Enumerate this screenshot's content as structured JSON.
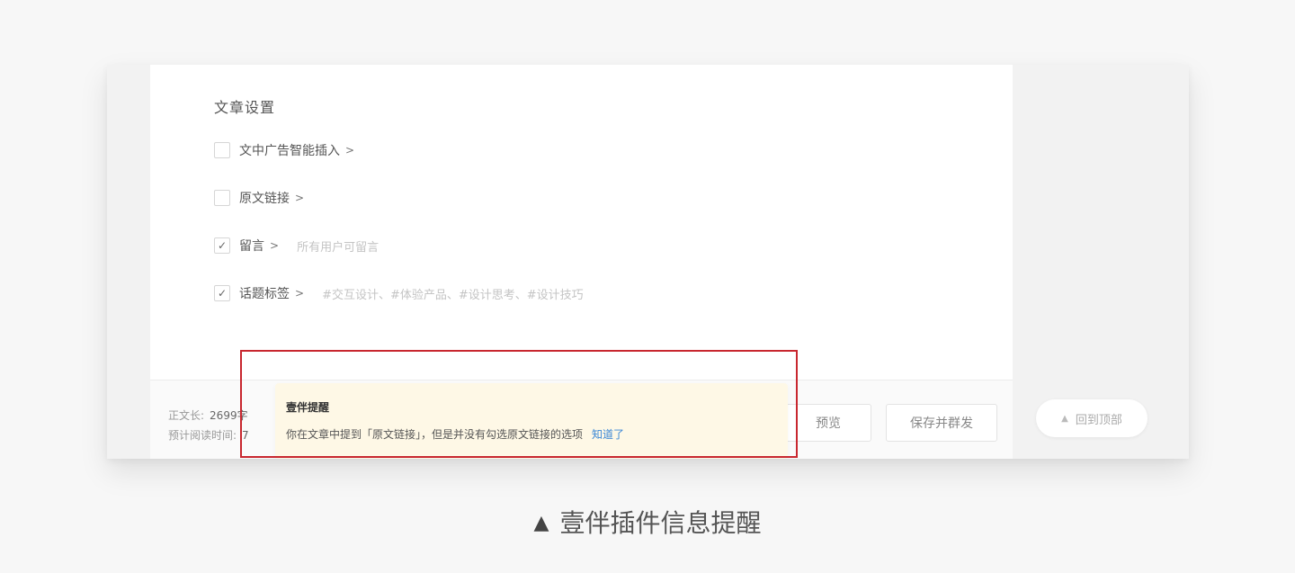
{
  "article_settings": {
    "title": "文章设置",
    "options": [
      {
        "label": "文中广告智能插入",
        "checked": false,
        "hint": ""
      },
      {
        "label": "原文链接",
        "checked": false,
        "hint": ""
      },
      {
        "label": "留言",
        "checked": true,
        "hint": "所有用户可留言"
      },
      {
        "label": "话题标签",
        "checked": true,
        "hint": "#交互设计、#体验产品、#设计思考、#设计技巧"
      }
    ]
  },
  "footer": {
    "word_count_label": "正文长:",
    "word_count_value": "2699字",
    "read_time_label": "预计阅读时间:",
    "read_time_value": "7"
  },
  "buttons": {
    "preview_label": "预览",
    "save_label": "保存并群发",
    "back_to_top_label": "回到顶部"
  },
  "tip": {
    "title": "壹伴提醒",
    "body": "你在文章中提到「原文链接」，但是并没有勾选原文链接的选项",
    "link": "知道了"
  },
  "caption": {
    "marker": "▲",
    "text": "壹伴插件信息提醒"
  },
  "colors": {
    "highlight": "#c8272f",
    "tip_background": "#fef8e6",
    "link": "#3b87d6"
  }
}
